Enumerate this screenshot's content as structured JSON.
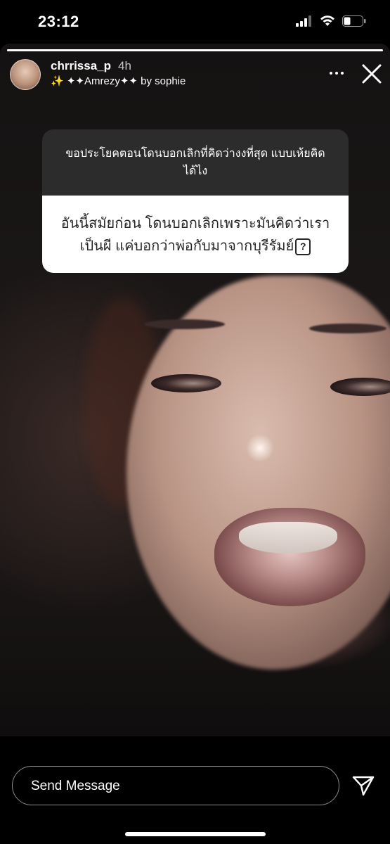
{
  "status_bar": {
    "time": "23:12",
    "icons": [
      "cellular-signal-icon",
      "wifi-icon",
      "battery-icon"
    ]
  },
  "story": {
    "progress": 1.0,
    "username": "chrrissa_p",
    "time_ago": "4h",
    "music": "✨ ✦✦Amrezy✦✦ by sophie",
    "icons": [
      "more-icon",
      "close-icon"
    ]
  },
  "question_sticker": {
    "question": "ขอประโยคตอนโดนบอกเลิกที่คิดว่างงที่สุด แบบเห้ยคิดได้ไง",
    "answer": "อันนี้สมัยก่อน โดนบอกเลิกเพราะมันคิดว่าเราเป็นผี แค่บอกว่าพ่อกับมาจากบุรีรัมย์",
    "answer_emoji": "?"
  },
  "reply_bar": {
    "placeholder": "Send Message",
    "send_icon": "paper-plane-icon"
  },
  "colors": {
    "background": "#000000",
    "card_top": "#323232",
    "card_bottom": "#ffffff",
    "card_text": "#262626"
  }
}
